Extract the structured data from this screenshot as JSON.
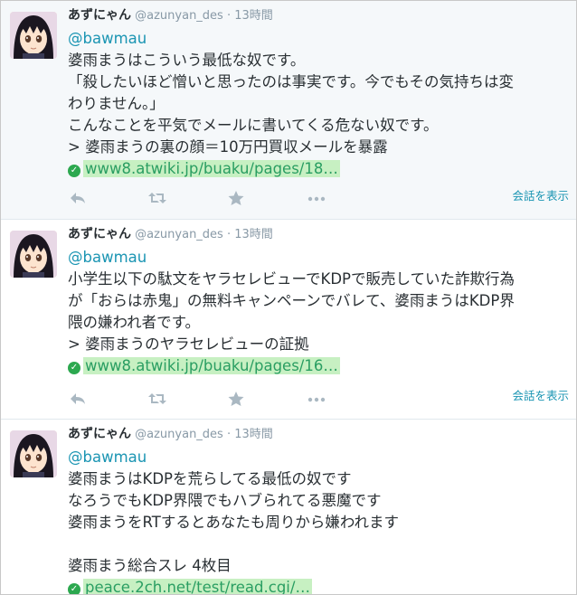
{
  "tweets": [
    {
      "name": "あずにゃん",
      "handle": "@azunyan_des",
      "dot": "·",
      "time": "13時間",
      "mention": "@bawmau",
      "lines": [
        "婆雨まうはこういう最低な奴です。",
        "「殺したいほど憎いと思ったのは事実です。今でもその気持ちは変",
        "わりません。」",
        "こんなことを平気でメールに書いてくる危ない奴です。",
        "> 婆雨まうの裏の顔＝10万円買収メールを暴露"
      ],
      "link": "www8.atwiki.jp/buaku/pages/18…",
      "show_conversation": "会話を表示"
    },
    {
      "name": "あずにゃん",
      "handle": "@azunyan_des",
      "dot": "·",
      "time": "13時間",
      "mention": "@bawmau",
      "lines": [
        "小学生以下の駄文をヤラセレビューでKDPで販売していた詐欺行為",
        "が「おらは赤鬼」の無料キャンペーンでバレて、婆雨まうはKDP界",
        "隈の嫌われ者です。",
        "> 婆雨まうのヤラセレビューの証拠"
      ],
      "link": "www8.atwiki.jp/buaku/pages/16…",
      "show_conversation": "会話を表示"
    },
    {
      "name": "あずにゃん",
      "handle": "@azunyan_des",
      "dot": "·",
      "time": "13時間",
      "mention": "@bawmau",
      "lines": [
        "婆雨まうはKDPを荒らしてる最低の奴です",
        "なろうでもKDP界隈でもハブられてる悪魔です",
        "婆雨まうをRTするとあなたも周りから嫌われます",
        "",
        "婆雨まう総合スレ 4枚目"
      ],
      "link": "peace.2ch.net/test/read.cgi/…"
    }
  ],
  "icons": [
    "reply-icon",
    "retweet-icon",
    "favorite-icon",
    "more-icon",
    "verified-link-icon"
  ],
  "colors": {
    "link_text": "#2a9e62",
    "link_highlight": "#c7f0c2",
    "mention": "#1b95b3",
    "muted": "#8899a6",
    "icon": "#aab8c2",
    "selected_bg": "#f5f8fa"
  }
}
